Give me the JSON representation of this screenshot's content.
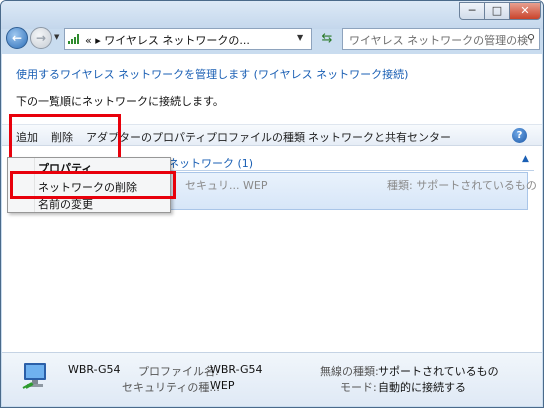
{
  "window": {
    "min_label": "─",
    "max_label": "□",
    "close_label": "✕"
  },
  "nav": {
    "back_label": "←",
    "forward_label": "→",
    "address_text": "« ▸ ワイヤレス ネットワークの...",
    "search_placeholder": "ワイヤレス ネットワークの管理の検索"
  },
  "header": {
    "manage_link": "使用するワイヤレス ネットワークを管理します (ワイヤレス ネットワーク接続)",
    "subtitle": "下の一覧順にネットワークに接続します。"
  },
  "toolbar": {
    "add": "追加",
    "delete": "削除",
    "adapter_properties": "アダプターのプロパティ",
    "profile_types": "プロファイルの種類",
    "network_center": "ネットワークと共有センター",
    "help": "?"
  },
  "group": {
    "header": "表示、修正、並べ替えが可能なネットワーク (1)",
    "chevron": "▲"
  },
  "network_row": {
    "security": "セキュリ... WEP",
    "type": "種類: サポートされているもの"
  },
  "context_menu": {
    "items": [
      "プロパティ",
      "ネットワークの削除",
      "名前の変更"
    ]
  },
  "details": {
    "name": "WBR-G54",
    "profile_label": "プロファイル名:",
    "profile_value": "WBR-G54",
    "security_label": "セキュリティの種...",
    "security_value": "WEP",
    "radio_label": "無線の種類:",
    "radio_value": "サポートされているもの",
    "mode_label": "モード:",
    "mode_value": "自動的に接続する"
  }
}
